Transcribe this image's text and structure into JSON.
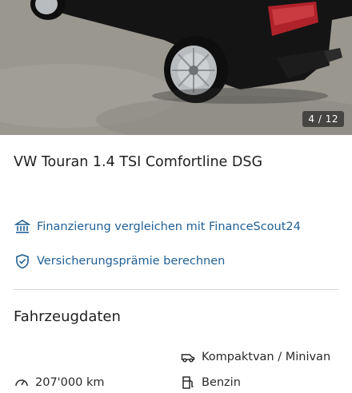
{
  "gallery": {
    "counter": "4 / 12",
    "photo_subject": "car-rear-photo"
  },
  "listing": {
    "title": "VW Touran 1.4 TSI Comfortline DSG"
  },
  "links": {
    "financing": {
      "label": "Finanzierung vergleichen mit FinanceScout24",
      "icon": "bank-icon"
    },
    "insurance": {
      "label": "Versicherungsprämie berechnen",
      "icon": "shield-check-icon"
    }
  },
  "vehicle_data": {
    "heading": "Fahrzeugdaten",
    "specs": [
      {
        "icon": "car-body-icon",
        "value": "Kompaktvan / Minivan"
      },
      {
        "icon": "odometer-icon",
        "value": "207'000 km"
      },
      {
        "icon": "fuel-icon",
        "value": "Benzin"
      }
    ]
  },
  "colors": {
    "link": "#1f5f95",
    "divider": "#d6d6d6"
  }
}
